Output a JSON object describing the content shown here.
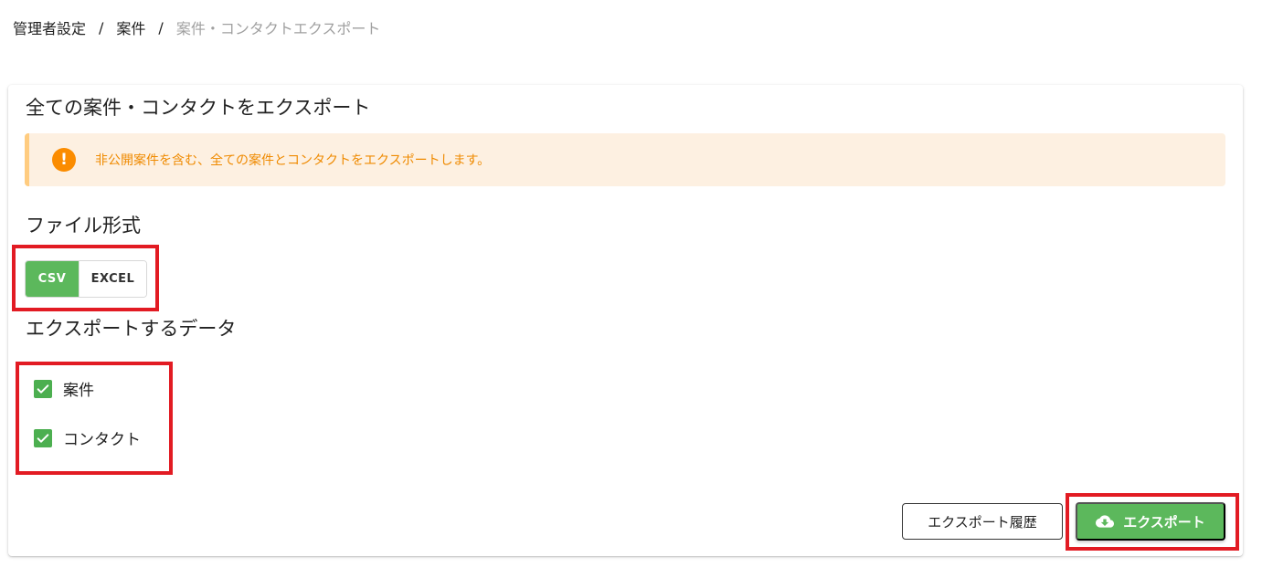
{
  "breadcrumb": {
    "items": [
      "管理者設定",
      "案件",
      "案件・コンタクトエクスポート"
    ],
    "separator": "/"
  },
  "card": {
    "title": "全ての案件・コンタクトをエクスポート",
    "alert": {
      "icon": "exclamation-icon",
      "text": "非公開案件を含む、全ての案件とコンタクトをエクスポートします。"
    },
    "file_format": {
      "title": "ファイル形式",
      "options": [
        "CSV",
        "EXCEL"
      ],
      "selected": "CSV"
    },
    "export_data": {
      "title": "エクスポートするデータ",
      "items": [
        {
          "label": "案件",
          "checked": true
        },
        {
          "label": "コンタクト",
          "checked": true
        }
      ]
    },
    "buttons": {
      "history": "エクスポート履歴",
      "export": "エクスポート",
      "export_icon": "cloud-download-icon"
    }
  },
  "colors": {
    "accent_green": "#5cb85c",
    "alert_bg": "#fdf0e1",
    "alert_text": "#ef8a00",
    "highlight_red": "#e21b23"
  }
}
